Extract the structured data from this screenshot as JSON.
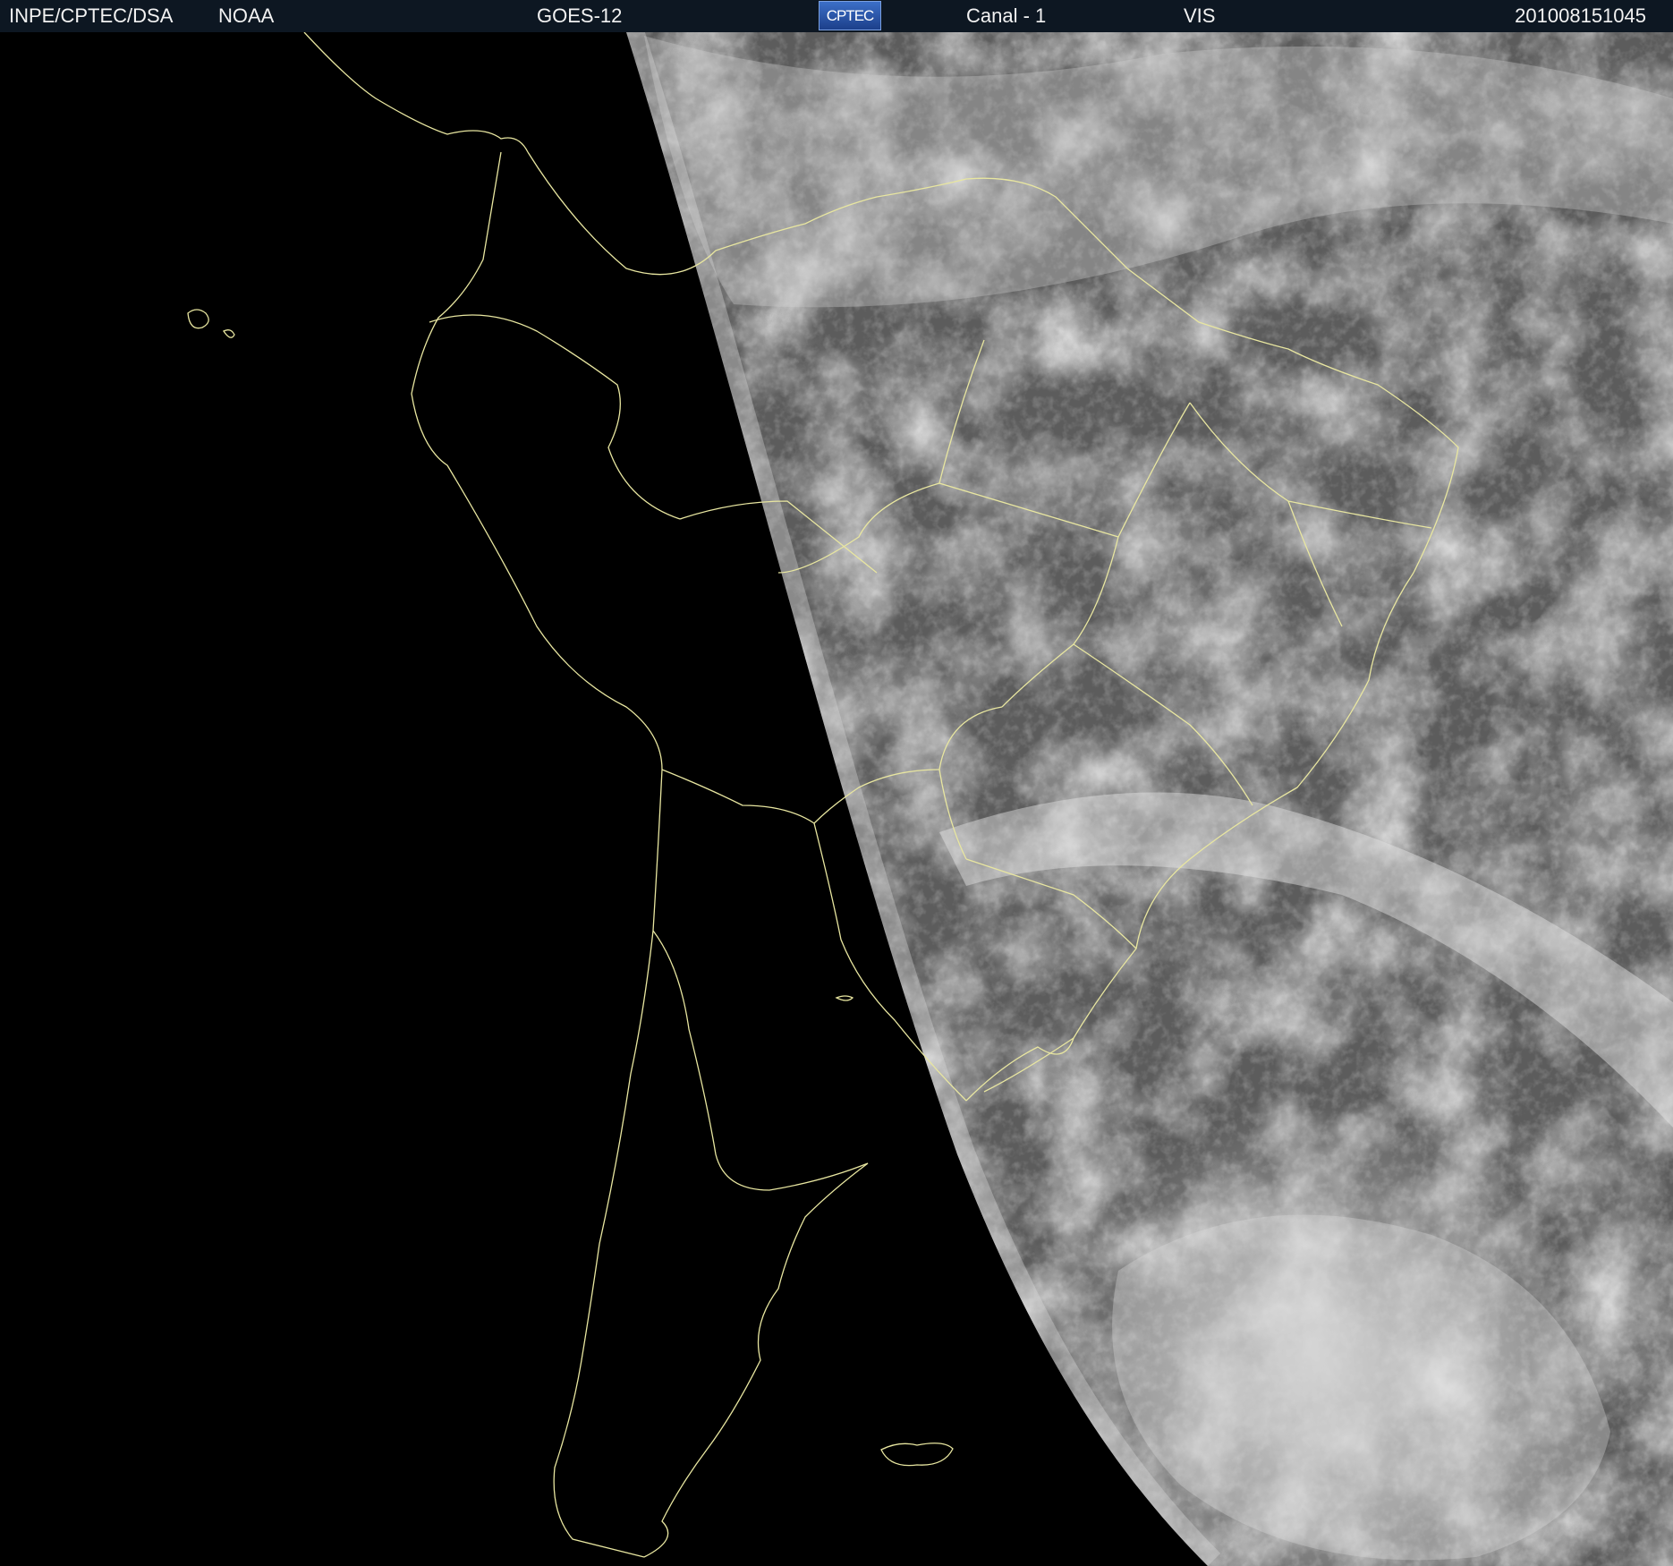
{
  "header": {
    "org": "INPE/CPTEC/DSA",
    "agency": "NOAA",
    "satellite": "GOES-12",
    "logo_text": "CPTEC",
    "channel": "Canal - 1",
    "band": "VIS",
    "timestamp": "201008151045"
  },
  "colors": {
    "header_bg": "#0d1722",
    "space": "#000000",
    "borders": "#e8e6a0",
    "clouds": "#ffffff"
  },
  "image_description": "GOES-12 visible-channel satellite image over South America with yellow political borders; western half in night-side darkness"
}
